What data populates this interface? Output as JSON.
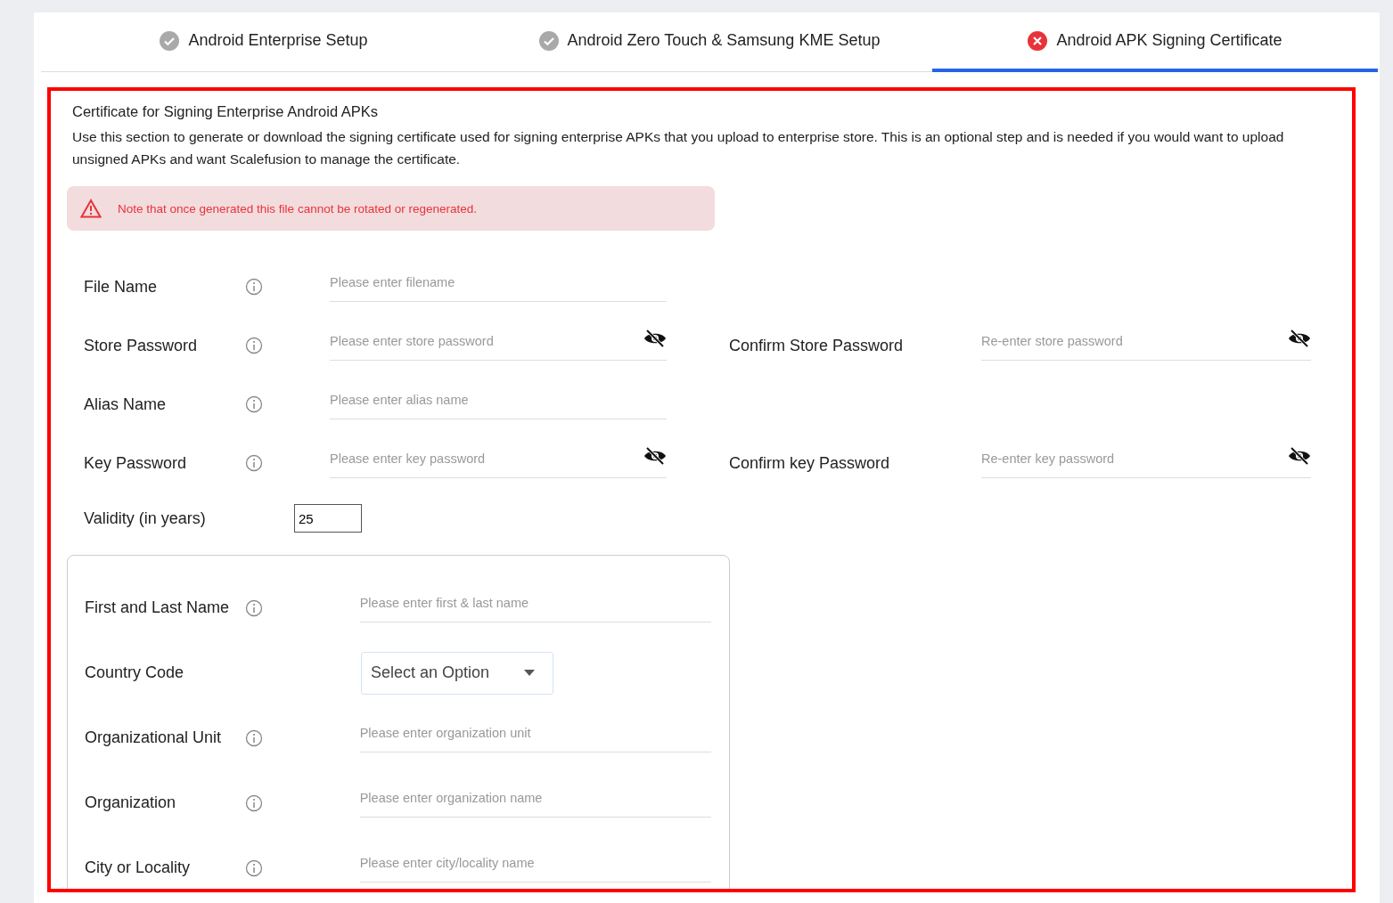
{
  "tabs": [
    {
      "label": "Android Enterprise Setup",
      "kind": "done",
      "selected": false
    },
    {
      "label": "Android Zero Touch & Samsung KME Setup",
      "kind": "done",
      "selected": false
    },
    {
      "label": "Android APK Signing Certificate",
      "kind": "error",
      "selected": true
    }
  ],
  "section": {
    "title": "Certificate for Signing Enterprise Android APKs",
    "description": "Use this section to generate or download the signing certificate used for signing enterprise APKs that you upload to enterprise store. This is an optional step and is needed if you would want to upload unsigned APKs and want Scalefusion to manage the certificate."
  },
  "alert": {
    "text": "Note that once generated this file cannot be rotated or regenerated."
  },
  "fields": [
    {
      "label": "File Name",
      "info": true,
      "kind": "text",
      "placeholder": "Please enter filename"
    },
    {
      "label": "Store Password",
      "info": true,
      "kind": "password",
      "placeholder": "Please enter store password",
      "confirm": {
        "label": "Confirm Store Password",
        "placeholder": "Re-enter store password"
      }
    },
    {
      "label": "Alias Name",
      "info": true,
      "kind": "text",
      "placeholder": "Please enter alias name"
    },
    {
      "label": "Key Password",
      "info": true,
      "kind": "password",
      "placeholder": "Please enter key password",
      "confirm": {
        "label": "Confirm key Password",
        "placeholder": "Re-enter key password"
      }
    }
  ],
  "validity": {
    "label": "Validity (in years)",
    "value": "25"
  },
  "owner_fields": [
    {
      "label": "First and Last Name",
      "info": true,
      "kind": "text",
      "placeholder": "Please enter first & last name"
    },
    {
      "label": "Country Code",
      "info": false,
      "kind": "select",
      "value": "Select an Option"
    },
    {
      "label": "Organizational Unit",
      "info": true,
      "kind": "text",
      "placeholder": "Please enter organization unit"
    },
    {
      "label": "Organization",
      "info": true,
      "kind": "text",
      "placeholder": "Please enter organization name"
    },
    {
      "label": "City or Locality",
      "info": true,
      "kind": "text",
      "placeholder": "Please enter city/locality name"
    }
  ]
}
